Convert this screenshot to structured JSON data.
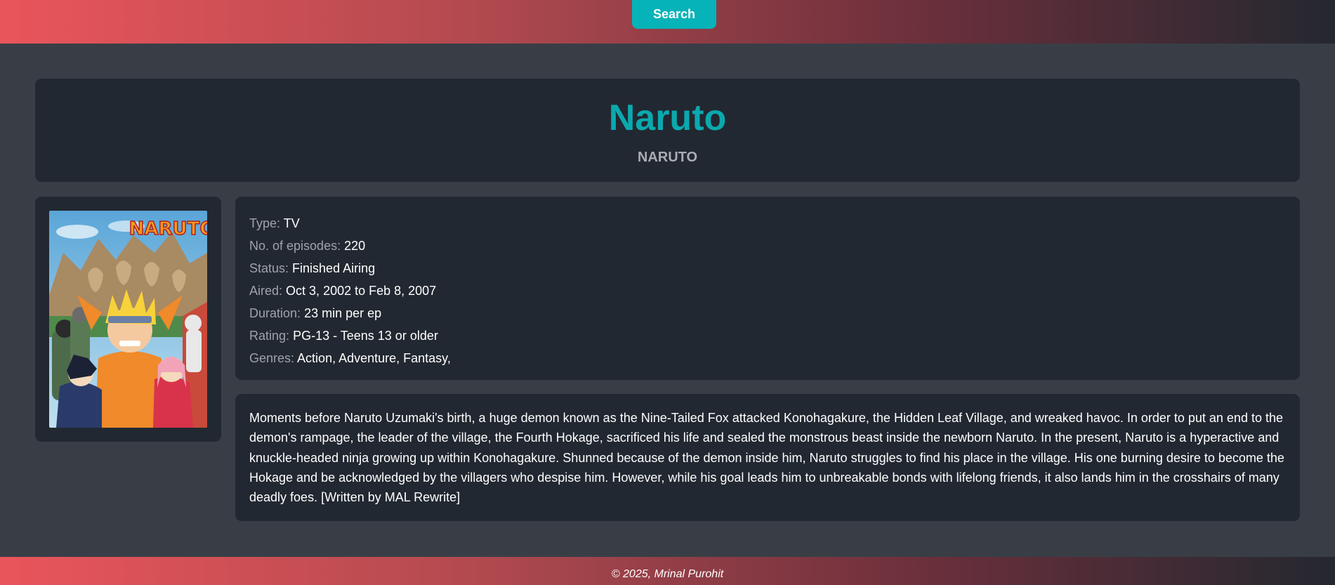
{
  "header": {
    "search_label": "Search"
  },
  "anime": {
    "title": "Naruto",
    "alt_title": "NARUTO",
    "poster_logo_text": "NARUTO",
    "details": [
      {
        "label": "Type:",
        "value": "TV"
      },
      {
        "label": "No. of episodes:",
        "value": "220"
      },
      {
        "label": "Status:",
        "value": "Finished Airing"
      },
      {
        "label": "Aired:",
        "value": "Oct 3, 2002 to Feb 8, 2007"
      },
      {
        "label": "Duration:",
        "value": "23 min per ep"
      },
      {
        "label": "Rating:",
        "value": "PG-13 - Teens 13 or older"
      },
      {
        "label": "Genres:",
        "value": "Action, Adventure, Fantasy,"
      }
    ],
    "synopsis": "Moments before Naruto Uzumaki's birth, a huge demon known as the Nine-Tailed Fox attacked Konohagakure, the Hidden Leaf Village, and wreaked havoc. In order to put an end to the demon's rampage, the leader of the village, the Fourth Hokage, sacrificed his life and sealed the monstrous beast inside the newborn Naruto. In the present, Naruto is a hyperactive and knuckle-headed ninja growing up within Konohagakure. Shunned because of the demon inside him, Naruto struggles to find his place in the village. His one burning desire to become the Hokage and be acknowledged by the villagers who despise him. However, while his goal leads him to unbreakable bonds with lifelong friends, it also lands him in the crosshairs of many deadly foes. [Written by MAL Rewrite]"
  },
  "footer": {
    "text": "© 2025, Mrinal Purohit"
  },
  "colors": {
    "accent": "#0aa9ae",
    "button": "#06b3b8",
    "card_bg": "#222831",
    "page_bg": "#393e46",
    "gradient_start": "#e9555b",
    "gradient_end": "#242830"
  }
}
